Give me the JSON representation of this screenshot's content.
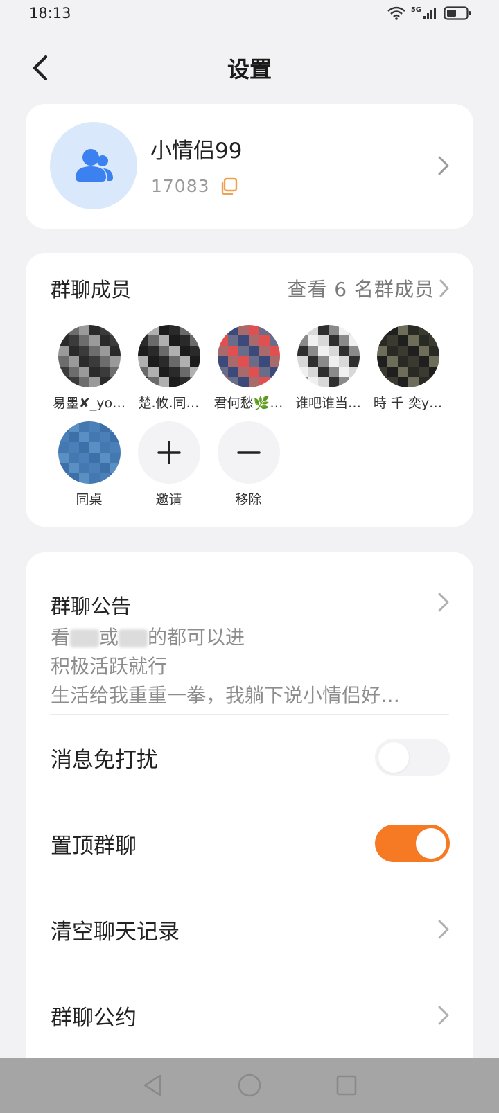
{
  "status_bar": {
    "time": "18:13",
    "network": "5G"
  },
  "header": {
    "title": "设置"
  },
  "group": {
    "name": "小情侣99",
    "id": "17083"
  },
  "members": {
    "title": "群聊成员",
    "view_all": "查看 6 名群成员",
    "list": [
      {
        "name": "易墨✘_yo…",
        "colors": [
          "#3b3b3b",
          "#6d6d6d",
          "#9a9a9a",
          "#2a2a2a"
        ]
      },
      {
        "name": "楚.攸.同…",
        "colors": [
          "#2a2a2a",
          "#6a6a6a",
          "#b0b0b0",
          "#1c1c1c"
        ]
      },
      {
        "name": "君何愁🌿…",
        "colors": [
          "#a86a6a",
          "#e05050",
          "#6a6d8a",
          "#3b4a7a"
        ]
      },
      {
        "name": "谁吧谁当…",
        "colors": [
          "#d8d8d8",
          "#2f2f2f",
          "#8a8a8a",
          "#f0f0f0"
        ]
      },
      {
        "name": "時 千 奕y…",
        "colors": [
          "#3a3a30",
          "#1f1f1f",
          "#6d6d5a",
          "#2a2a24"
        ]
      },
      {
        "name": "同桌",
        "colors": [
          "#4a7fb8",
          "#3d6fa8",
          "#5a8fc4",
          "#4478b0"
        ]
      }
    ],
    "invite_label": "邀请",
    "remove_label": "移除"
  },
  "announcement": {
    "title": "群聊公告",
    "line1_a": "看",
    "line1_b": "或",
    "line1_c": "的都可以进",
    "line2": "积极活跃就行",
    "line3": "生活给我重重一拳，我躺下说小情侣好…"
  },
  "settings": {
    "mute_label": "消息免打扰",
    "mute_on": false,
    "pin_label": "置顶群聊",
    "pin_on": true,
    "clear_label": "清空聊天记录",
    "convention_label": "群聊公约"
  },
  "colors": {
    "accent": "#f57a23",
    "avatar_bg": "#d9e8fb",
    "avatar_icon": "#3b82f0"
  }
}
